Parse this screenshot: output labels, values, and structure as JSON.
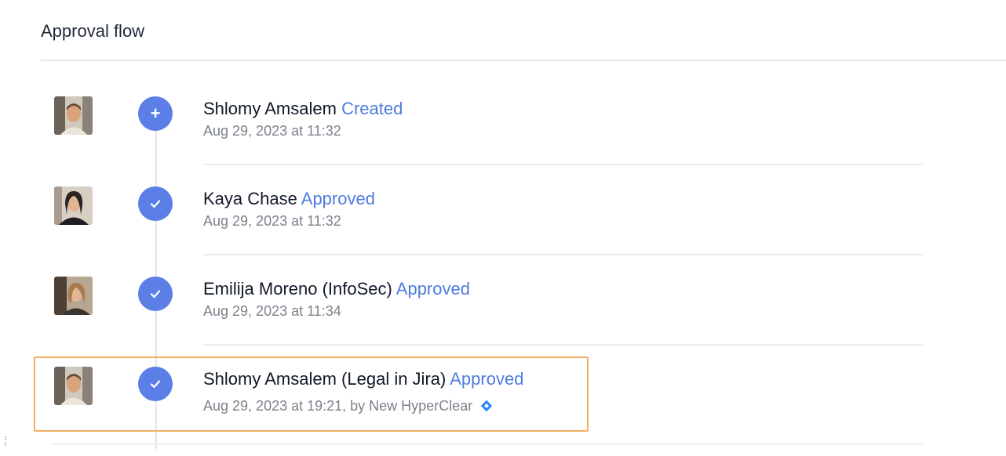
{
  "section": {
    "title": "Approval flow"
  },
  "items": [
    {
      "name": "Shlomy Amsalem",
      "action": "Created",
      "time": "Aug 29, 2023 at 11:32",
      "icon": "plus-icon"
    },
    {
      "name": "Kaya Chase",
      "action": "Approved",
      "time": "Aug 29, 2023 at 11:32",
      "icon": "check-icon"
    },
    {
      "name": "Emilija Moreno (InfoSec)",
      "action": "Approved",
      "time": "Aug 29, 2023 at 11:34",
      "icon": "check-icon"
    },
    {
      "name": "Shlomy Amsalem (Legal in Jira)",
      "action": "Approved",
      "time": "Aug 29, 2023 at 19:21, by New HyperClear",
      "icon": "check-icon",
      "source_icon": "jira-icon"
    }
  ],
  "colors": {
    "accent": "#4f7be0",
    "step_circle": "#5b7fe6",
    "highlight": "#f0b061"
  }
}
